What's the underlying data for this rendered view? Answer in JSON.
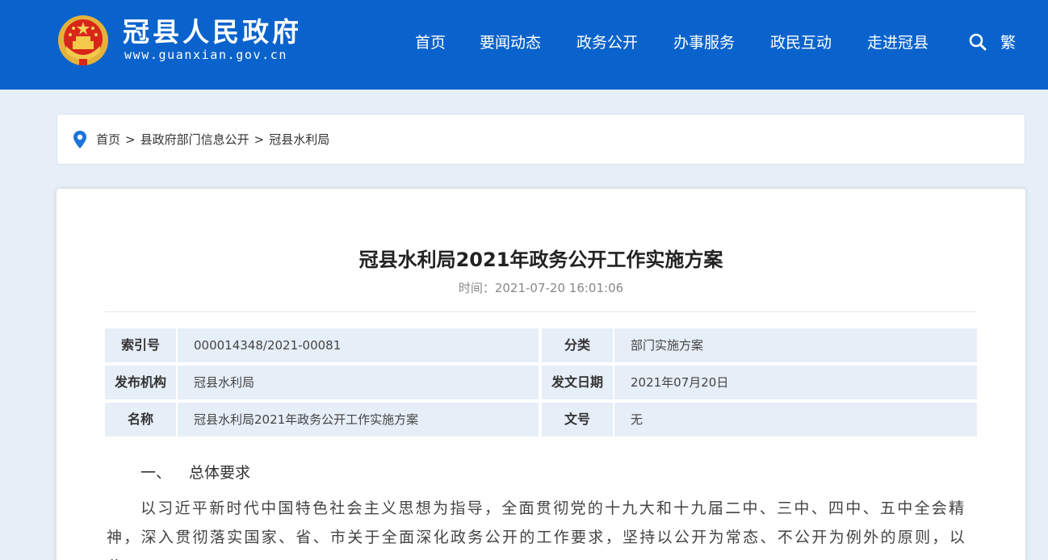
{
  "header": {
    "site_name": "冠县人民政府",
    "site_url": "www.guanxian.gov.cn",
    "nav": [
      {
        "label": "首页"
      },
      {
        "label": "要闻动态"
      },
      {
        "label": "政务公开"
      },
      {
        "label": "办事服务"
      },
      {
        "label": "政民互动"
      },
      {
        "label": "走进冠县"
      }
    ],
    "traditional_label": "繁",
    "search_icon": "search-icon"
  },
  "breadcrumb": {
    "icon": "location-pin-icon",
    "items": [
      "首页",
      "县政府部门信息公开",
      "冠县水利局"
    ],
    "separator": ">"
  },
  "article": {
    "title": "冠县水利局2021年政务公开工作实施方案",
    "time_label": "时间：",
    "time_value": "2021-07-20 16:01:06",
    "info": {
      "index_label": "索引号",
      "index_value": "000014348/2021-00081",
      "category_label": "分类",
      "category_value": "部门实施方案",
      "publisher_label": "发布机构",
      "publisher_value": "冠县水利局",
      "date_label": "发文日期",
      "date_value": "2021年07月20日",
      "name_label": "名称",
      "name_value": "冠县水利局2021年政务公开工作实施方案",
      "doc_no_label": "文号",
      "doc_no_value": "无"
    },
    "section_number": "一、",
    "section_title": "总体要求",
    "paragraph": "以习近平新时代中国特色社会主义思想为指导，全面贯彻党的十九大和十九届二中、三中、四中、五中全会精神，深入贯彻落实国家、省、市关于全面深化政务公开的工作要求，坚持以公开为常态、不公开为例外的原则，以公"
  },
  "colors": {
    "header_bg": "#0a63cc",
    "page_bg": "#e6eef8",
    "table_cell_bg": "#e6eef8",
    "pin": "#1a73d9"
  }
}
